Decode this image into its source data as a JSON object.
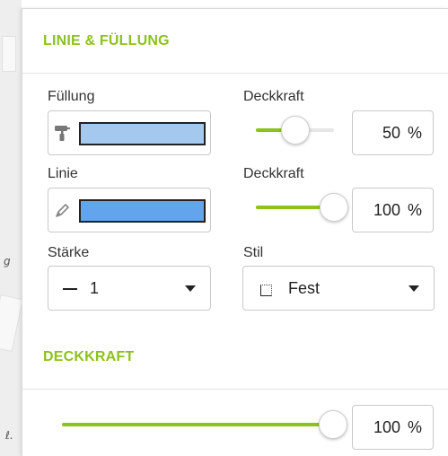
{
  "section_line_fill": {
    "title": "LINIE & FÜLLUNG",
    "fill": {
      "label": "Füllung",
      "icon": "paint-roller-icon",
      "color": "#a4c8ee",
      "opacity_label": "Deckkraft",
      "opacity_value": "50",
      "opacity_unit": "%",
      "opacity_fraction": 0.5
    },
    "line": {
      "label": "Linie",
      "icon": "pen-icon",
      "color": "#62a5ec",
      "opacity_label": "Deckkraft",
      "opacity_value": "100",
      "opacity_unit": "%",
      "opacity_fraction": 1.0
    },
    "weight": {
      "label": "Stärke",
      "icon": "line-weight-icon",
      "value": "1"
    },
    "style": {
      "label": "Stil",
      "icon": "dotted-square-icon",
      "value": "Fest"
    }
  },
  "section_opacity": {
    "title": "DECKKRAFT",
    "value": "100",
    "unit": "%",
    "fraction": 1.0
  },
  "colors": {
    "accent": "#8cc21a",
    "border": "#c9c9c9"
  },
  "background_fragments": {
    "glyph_1": "g",
    "glyph_2": "ℓ."
  }
}
